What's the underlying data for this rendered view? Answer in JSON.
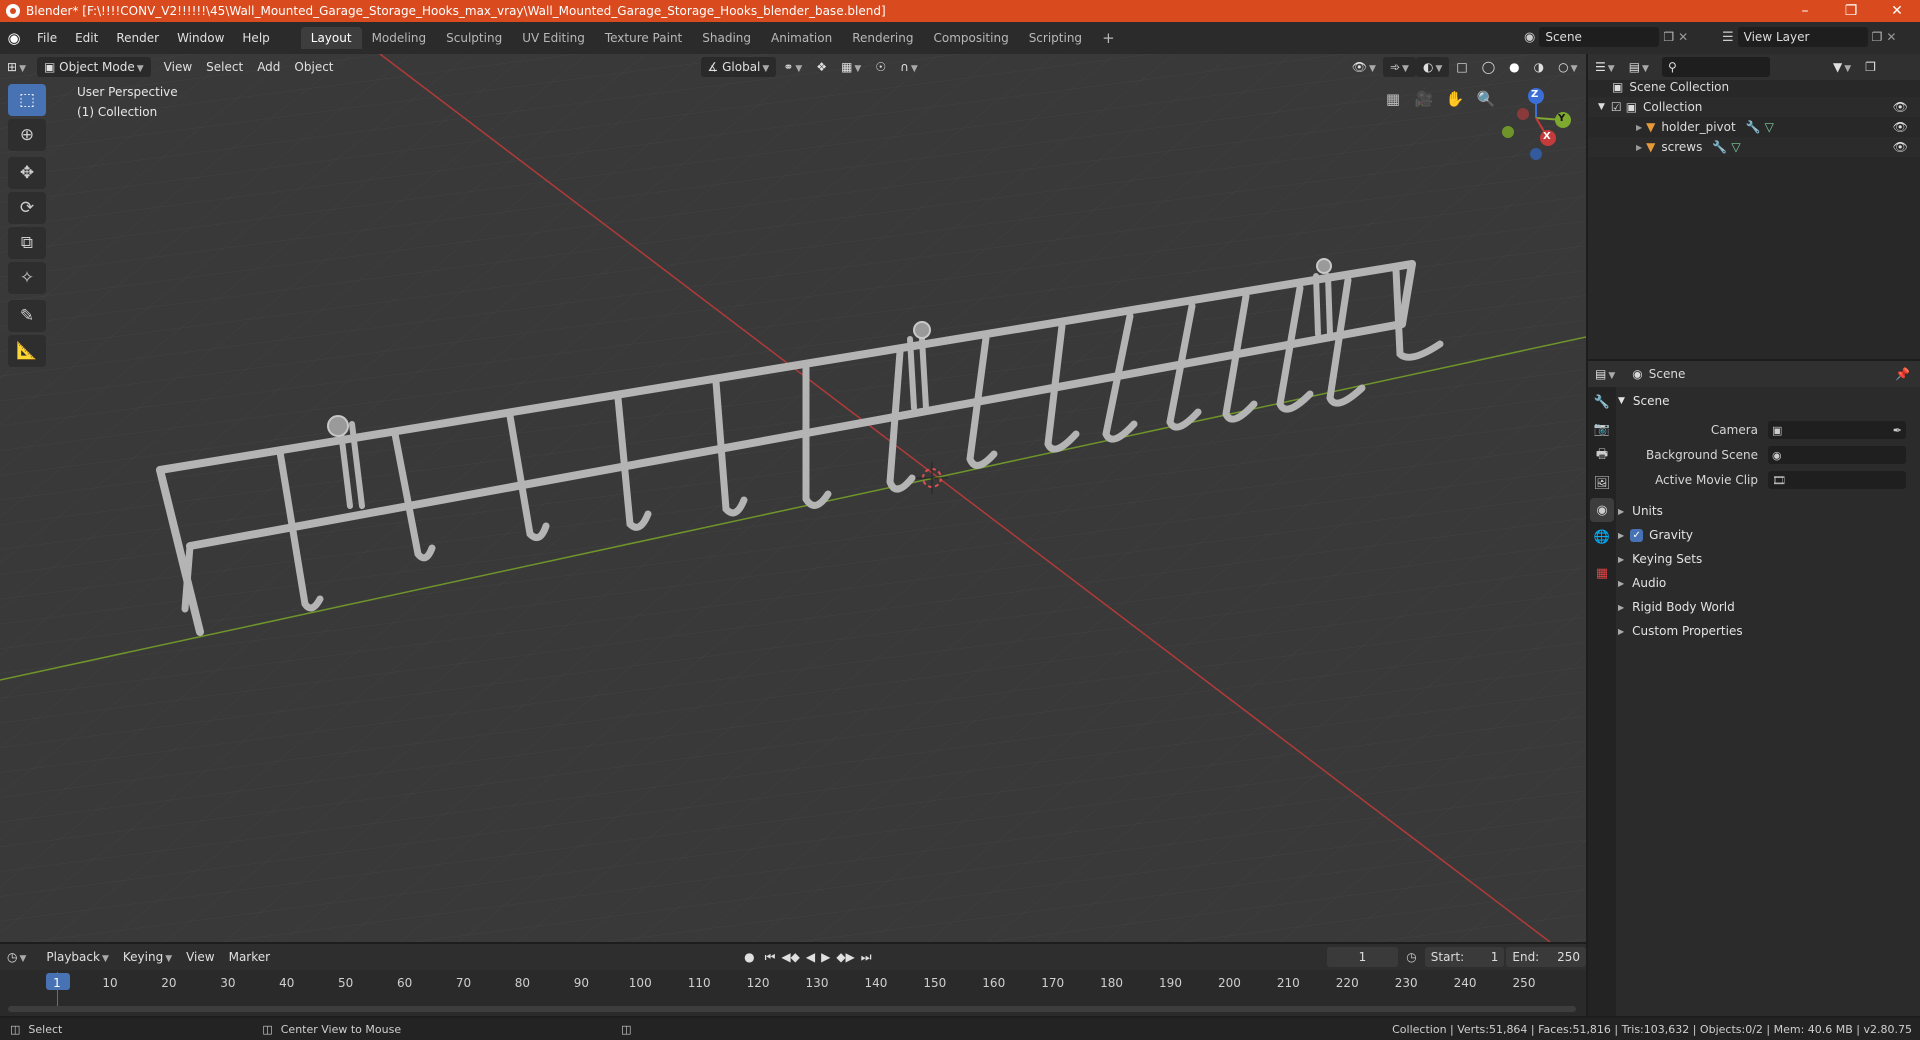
{
  "window": {
    "title": "Blender* [F:\\!!!!CONV_V2!!!!!!\\45\\Wall_Mounted_Garage_Storage_Hooks_max_vray\\Wall_Mounted_Garage_Storage_Hooks_blender_base.blend]"
  },
  "menus": [
    "File",
    "Edit",
    "Render",
    "Window",
    "Help"
  ],
  "workspaces": {
    "active": "Layout",
    "tabs": [
      "Layout",
      "Modeling",
      "Sculpting",
      "UV Editing",
      "Texture Paint",
      "Shading",
      "Animation",
      "Rendering",
      "Compositing",
      "Scripting"
    ]
  },
  "scene_selector": {
    "label": "Scene"
  },
  "view_layer_selector": {
    "label": "View Layer"
  },
  "viewport": {
    "mode": "Object Mode",
    "menus": [
      "View",
      "Select",
      "Add",
      "Object"
    ],
    "orientation": "Global",
    "info_line1": "User Perspective",
    "info_line2": "(1) Collection",
    "gizmo_axes": {
      "x": "X",
      "y": "Y",
      "z": "Z"
    }
  },
  "outliner": {
    "root": "Scene Collection",
    "collection": "Collection",
    "objects": [
      {
        "name": "holder_pivot"
      },
      {
        "name": "screws"
      }
    ]
  },
  "properties": {
    "header": "Scene",
    "panel_title": "Scene",
    "fields": {
      "camera": "Camera",
      "background_scene": "Background Scene",
      "active_movie_clip": "Active Movie Clip"
    },
    "subpanels": [
      "Units",
      "Gravity",
      "Keying Sets",
      "Audio",
      "Rigid Body World",
      "Custom Properties"
    ]
  },
  "timeline": {
    "menus": [
      "Playback",
      "Keying",
      "View",
      "Marker"
    ],
    "current_frame": "1",
    "start_label": "Start:",
    "start": "1",
    "end_label": "End:",
    "end": "250",
    "ruler": [
      "1",
      "10",
      "20",
      "30",
      "40",
      "50",
      "60",
      "70",
      "80",
      "90",
      "100",
      "110",
      "120",
      "130",
      "140",
      "150",
      "160",
      "170",
      "180",
      "190",
      "200",
      "210",
      "220",
      "230",
      "240",
      "250"
    ]
  },
  "statusbar": {
    "left_action": "Select",
    "middle_action": "Center View to Mouse",
    "stats": "Collection | Verts:51,864 | Faces:51,816 | Tris:103,632 | Objects:0/2 | Mem: 40.6 MB | v2.80.75"
  },
  "colors": {
    "accent": "#4772b3",
    "titlebar": "#d94a1e",
    "x_axis": "#c43b3b",
    "y_axis": "#7ea82f",
    "z_axis": "#3b6fd6"
  }
}
